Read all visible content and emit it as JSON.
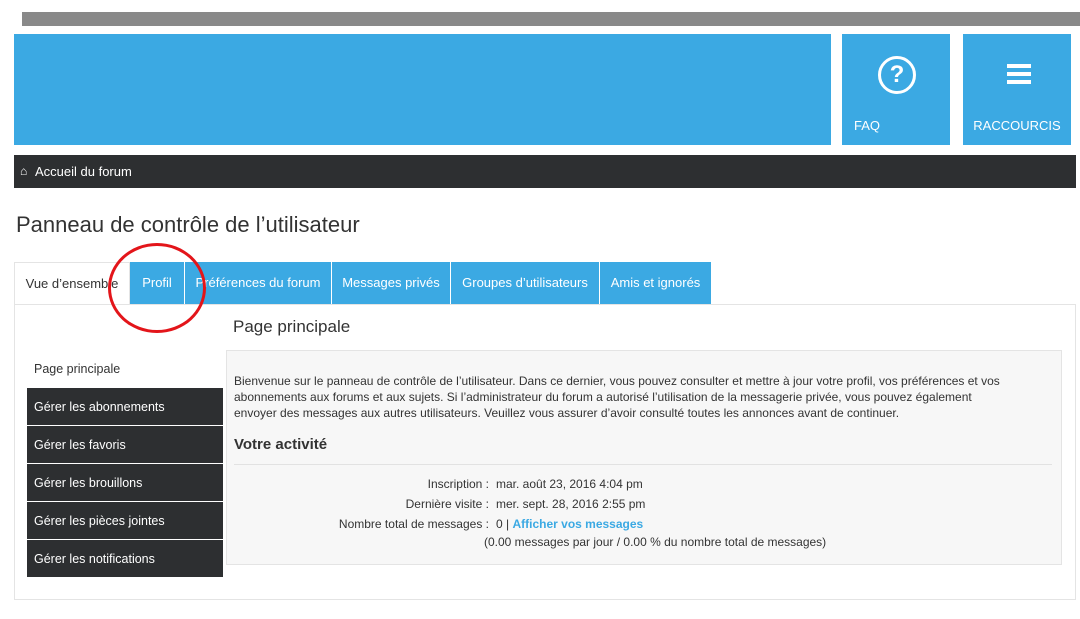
{
  "header": {
    "faq_label": "FAQ",
    "shortcuts_label": "RACCOURCIS",
    "faq_icon": "?"
  },
  "breadcrumb": {
    "home_icon": "⌂",
    "label": "Accueil du forum"
  },
  "page_title": "Panneau de contrôle de l’utilisateur",
  "tabs": [
    "Vue d’ensemble",
    "Profil",
    "Préférences du forum",
    "Messages privés",
    "Groupes d’utilisateurs",
    "Amis et ignorés"
  ],
  "sidebar": [
    "Page principale",
    "Gérer les abonnements",
    "Gérer les favoris",
    "Gérer les brouillons",
    "Gérer les pièces jointes",
    "Gérer les notifications"
  ],
  "main": {
    "title": "Page principale",
    "intro_1": "Bienvenue sur le panneau de contrôle de l’utilisateur. Dans ce dernier, vous pouvez consulter et mettre à jour votre profil, vos préférences et vos",
    "intro_2": "abonnements aux forums et aux sujets. Si l’administrateur du forum a autorisé l’utilisation de la messagerie privée, vous pouvez également",
    "intro_3": "envoyer des messages aux autres utilisateurs. Veuillez vous assurer d’avoir consulté toutes les annonces avant de continuer.",
    "activity_title": "Votre activité",
    "registration_label": "Inscription :",
    "registration_value": "mar. août 23, 2016 4:04 pm",
    "last_visit_label": "Dernière visite :",
    "last_visit_value": "mer. sept. 28, 2016 2:55 pm",
    "total_posts_label": "Nombre total de messages :",
    "total_posts_value": "0 |",
    "show_posts_link": "Afficher vos messages",
    "posts_stats": "(0.00 messages par jour / 0.00 % du nombre total de messages)"
  },
  "colors": {
    "accent": "#3ba9e3",
    "dark": "#2d2f31",
    "annotation": "#e3151a"
  }
}
